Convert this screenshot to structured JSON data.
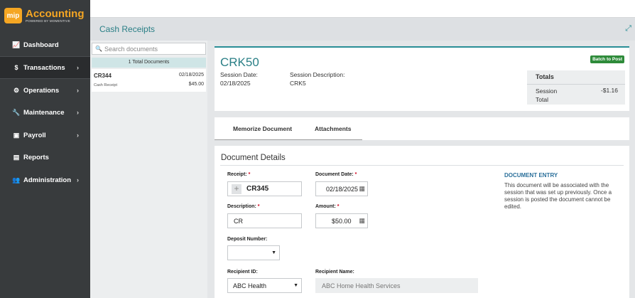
{
  "app": {
    "logo_badge": "mip",
    "logo_title": "Accounting",
    "logo_subtitle": "POWERED BY MOMENTIVE"
  },
  "sidebar": {
    "items": [
      {
        "label": "Dashboard",
        "icon": "chart-line-icon",
        "chevron": false
      },
      {
        "label": "Transactions",
        "icon": "dollar-icon",
        "chevron": true,
        "active": true
      },
      {
        "label": "Operations",
        "icon": "gears-icon",
        "chevron": true
      },
      {
        "label": "Maintenance",
        "icon": "wrench-icon",
        "chevron": true
      },
      {
        "label": "Payroll",
        "icon": "money-icon",
        "chevron": true
      },
      {
        "label": "Reports",
        "icon": "report-icon",
        "chevron": false
      },
      {
        "label": "Administration",
        "icon": "users-icon",
        "chevron": true
      }
    ]
  },
  "header": {
    "title": "Cash Receipts"
  },
  "doc_list": {
    "search_placeholder": "Search documents",
    "total_label": "1 Total Documents",
    "rows": [
      {
        "id": "CR344",
        "date": "02/18/2025",
        "type": "Cash Receipt",
        "amount": "$45.00"
      }
    ]
  },
  "session": {
    "id": "CRK50",
    "date_label": "Session Date:",
    "date_value": "02/18/2025",
    "desc_label": "Session Description:",
    "desc_value": "CRK5",
    "batch_button": "Batch to Post",
    "totals_title": "Totals",
    "totals_label": "Session Total",
    "totals_value": "-$1.16"
  },
  "tabs": [
    "Memorize Document",
    "Attachments"
  ],
  "details": {
    "title": "Document Details",
    "receipt_label": "Receipt:",
    "receipt_value": "CR345",
    "doc_date_label": "Document Date:",
    "doc_date_value": "02/18/2025",
    "description_label": "Description:",
    "description_value": "CR",
    "amount_label": "Amount:",
    "amount_value": "$50.00",
    "deposit_label": "Deposit Number:",
    "deposit_value": "",
    "recipient_id_label": "Recipient ID:",
    "recipient_id_value": "ABC Health",
    "recipient_name_label": "Recipient Name:",
    "recipient_name_value": "ABC Home Health Services",
    "entry_title": "DOCUMENT ENTRY",
    "entry_text": "This document will be associated with the session that was set up previously. Once a session is posted the document cannot be edited."
  },
  "colors": {
    "accent": "#2a8f96",
    "sidebar": "#383b3d",
    "logo": "#f5a623",
    "batch": "#2e8b3a",
    "required": "#d0021b"
  }
}
